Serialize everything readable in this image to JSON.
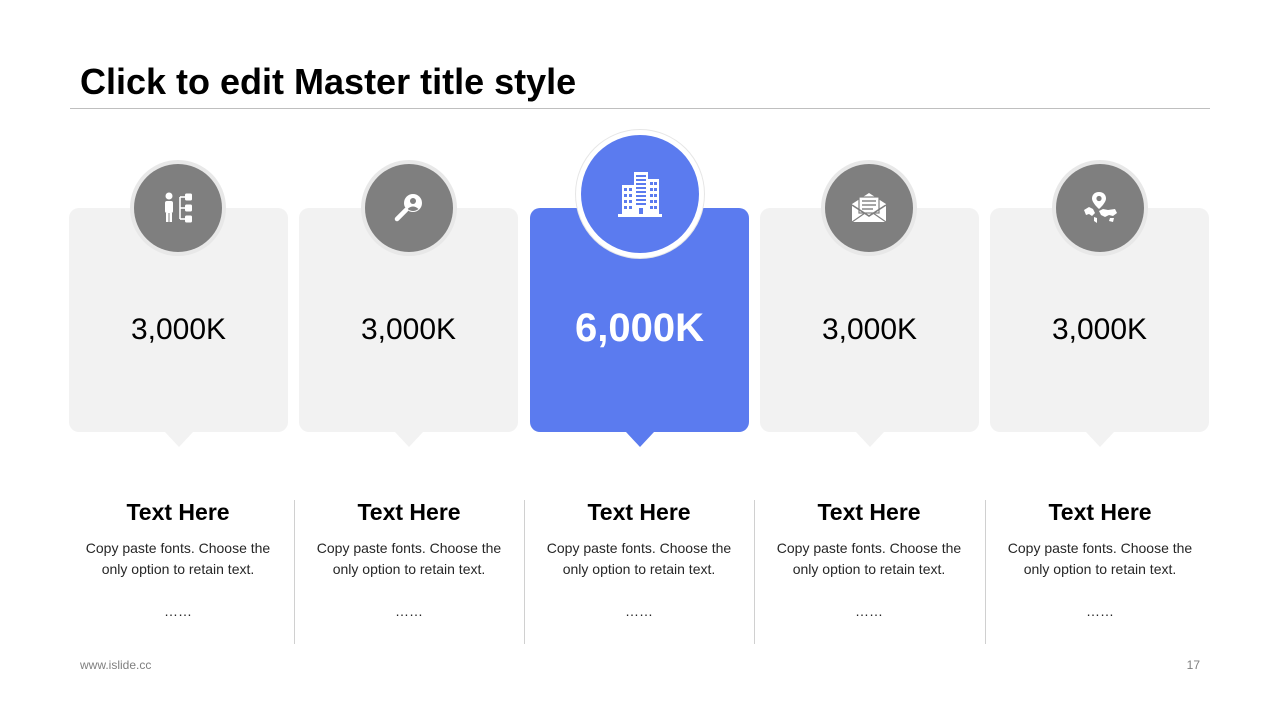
{
  "slide": {
    "title": "Click to edit Master title style",
    "footer_url": "www.islide.cc",
    "page_number": "17"
  },
  "colors": {
    "accent": "#5b7bef",
    "card_bg": "#f2f2f2",
    "icon_disc": "#7f7f7f"
  },
  "cards": [
    {
      "icon": "org-chart-icon",
      "value": "3,000K",
      "heading": "Text Here",
      "description": "Copy paste fonts. Choose the only option to retain text.",
      "more": "……",
      "highlighted": false
    },
    {
      "icon": "magnifier-icon",
      "value": "3,000K",
      "heading": "Text Here",
      "description": "Copy paste fonts. Choose the only option to retain text.",
      "more": "……",
      "highlighted": false
    },
    {
      "icon": "building-icon",
      "value": "6,000K",
      "heading": "Text Here",
      "description": "Copy paste fonts. Choose the only option to retain text.",
      "more": "……",
      "highlighted": true
    },
    {
      "icon": "envelope-icon",
      "value": "3,000K",
      "heading": "Text Here",
      "description": "Copy paste fonts. Choose the only option to retain text.",
      "more": "……",
      "highlighted": false
    },
    {
      "icon": "world-map-pin-icon",
      "value": "3,000K",
      "heading": "Text Here",
      "description": "Copy paste fonts. Choose the only option to retain text.",
      "more": "……",
      "highlighted": false
    }
  ]
}
